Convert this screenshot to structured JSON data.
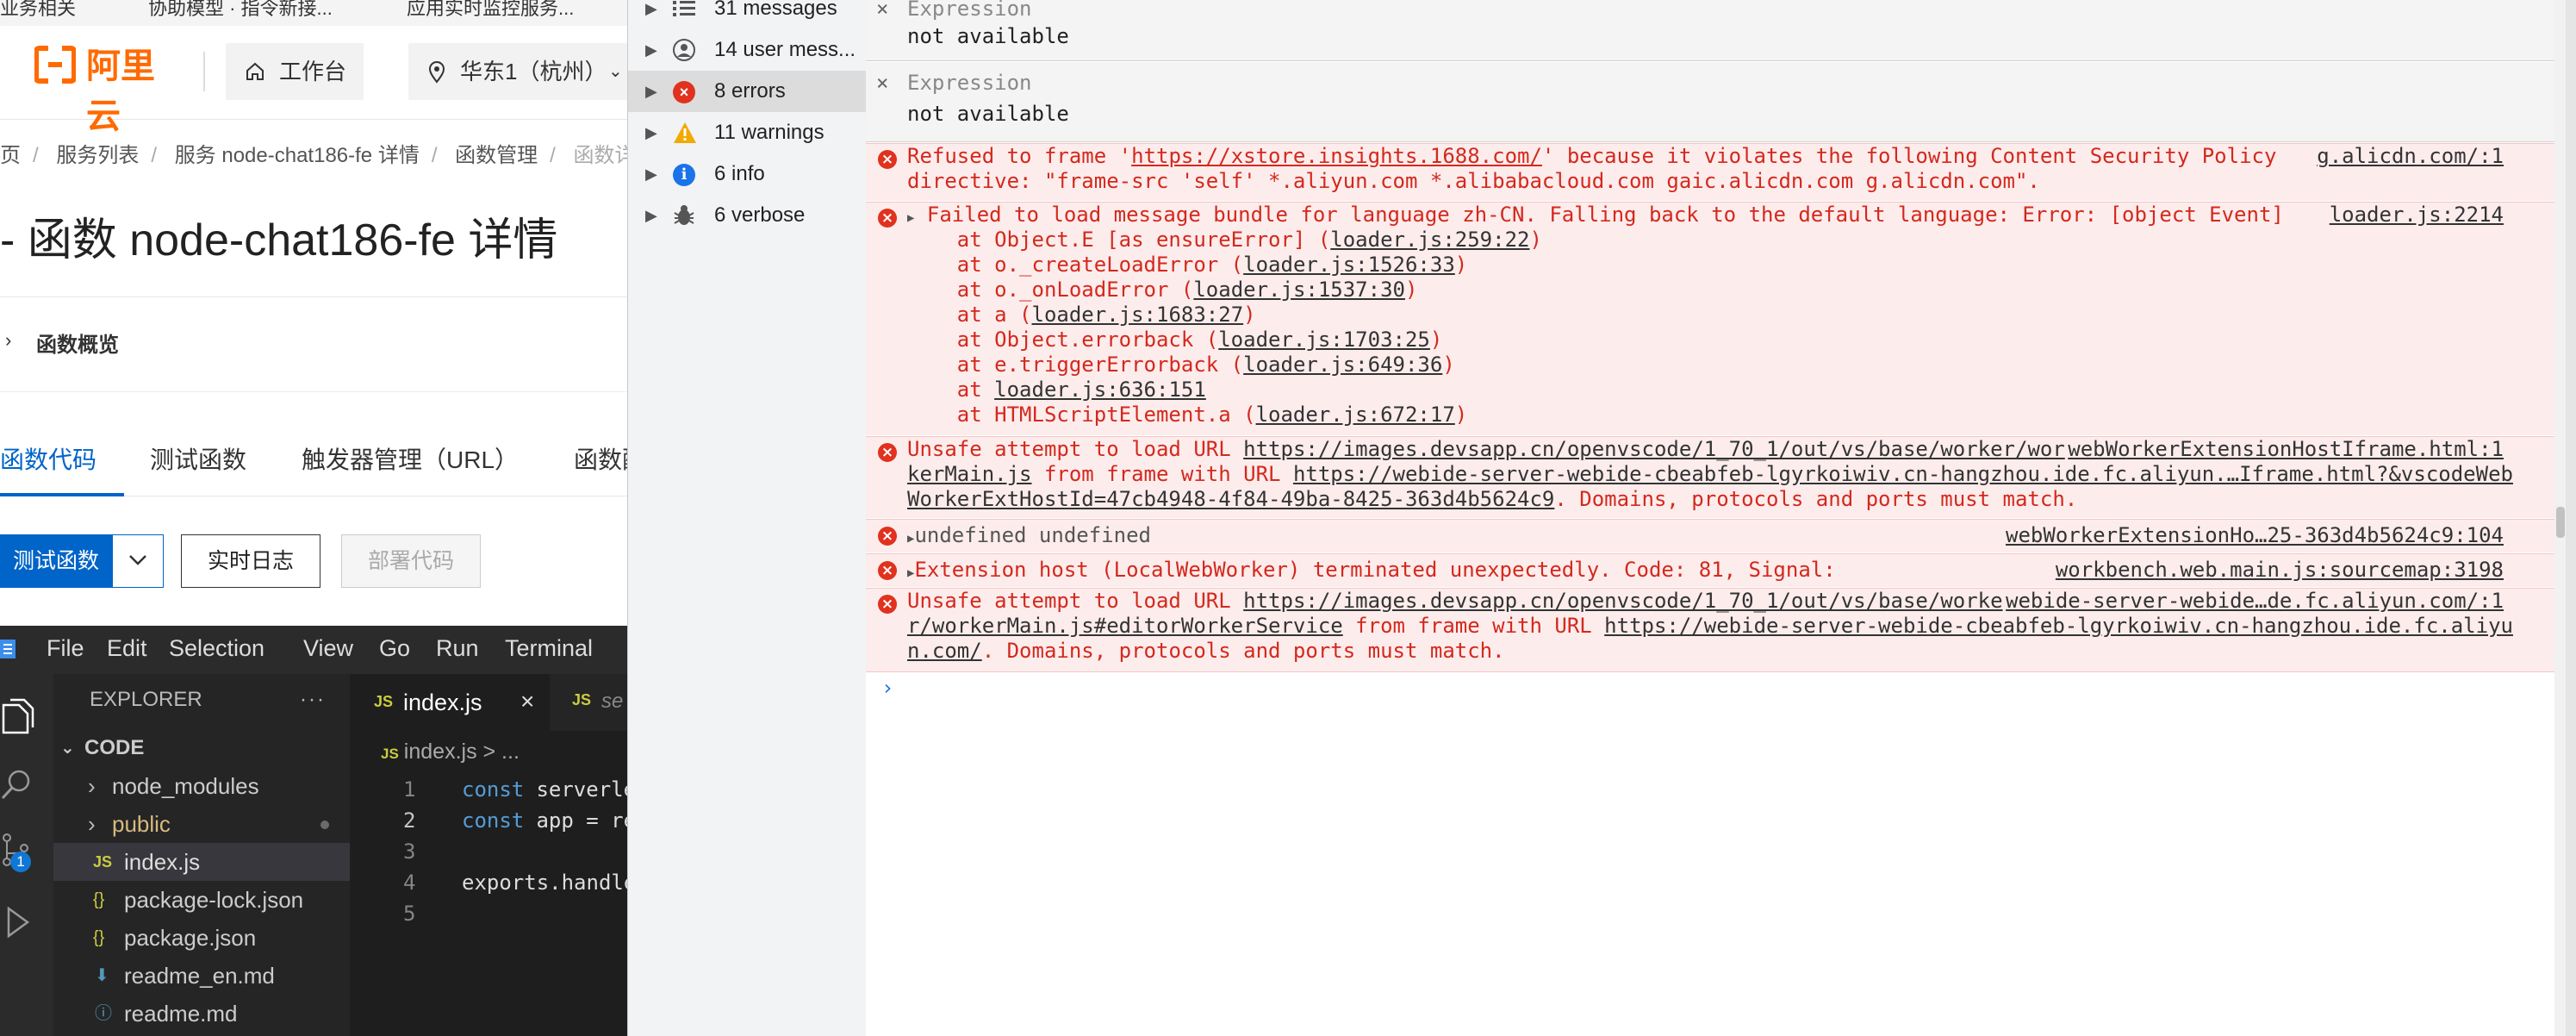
{
  "aliyun": {
    "bookmarks": [
      "业务相关",
      "协助模型 · 指令新接...",
      "应用实时监控服务..."
    ],
    "logo": "阿里云",
    "workbench": "工作台",
    "region": "华东1（杭州）",
    "breadcrumb": [
      "页",
      "服务列表",
      "服务 node-chat186-fe 详情",
      "函数管理",
      "函数详"
    ],
    "title": "- 函数 node-chat186-fe 详情",
    "overview": "函数概览",
    "tabs": [
      "函数代码",
      "测试函数",
      "触发器管理（URL）",
      "函数配"
    ],
    "buttons": {
      "test": "测试函数",
      "log": "实时日志",
      "deploy": "部署代码"
    }
  },
  "vscode": {
    "menu": [
      "File",
      "Edit",
      "Selection",
      "View",
      "Go",
      "Run",
      "Terminal"
    ],
    "explorer_title": "EXPLORER",
    "root": "CODE",
    "files": [
      {
        "name": "node_modules",
        "type": "folder"
      },
      {
        "name": "public",
        "type": "folder"
      },
      {
        "name": "index.js",
        "type": "js"
      },
      {
        "name": "package-lock.json",
        "type": "json"
      },
      {
        "name": "package.json",
        "type": "json"
      },
      {
        "name": "readme_en.md",
        "type": "md"
      },
      {
        "name": "readme.md",
        "type": "md"
      }
    ],
    "scm_badge": "1",
    "tab": "index.js",
    "tab2": "se",
    "editor_breadcrumb": "index.js > ...",
    "lines": [
      {
        "n": "1",
        "kw": "const",
        "rest": " serverle"
      },
      {
        "n": "2",
        "kw": "const",
        "rest": " app = re"
      },
      {
        "n": "3",
        "kw": "",
        "rest": ""
      },
      {
        "n": "4",
        "kw": "",
        "rest": "exports.handle"
      },
      {
        "n": "5",
        "kw": "",
        "rest": ""
      }
    ]
  },
  "sidebar": {
    "items": [
      {
        "label": "31 messages",
        "icon": "list-icon"
      },
      {
        "label": "14 user mess...",
        "icon": "user-icon"
      },
      {
        "label": "8 errors",
        "icon": "error-icon"
      },
      {
        "label": "11 warnings",
        "icon": "warning-icon"
      },
      {
        "label": "6 info",
        "icon": "info-icon"
      },
      {
        "label": "6 verbose",
        "icon": "bug-icon"
      }
    ]
  },
  "console": {
    "expressions": [
      {
        "title": "Expression",
        "value": "not available"
      },
      {
        "title": "Expression",
        "value": "not available"
      }
    ],
    "err1": {
      "l1a": "Refused to frame '",
      "l1link": "https://xstore.insights.1688.com/",
      "l1b": "' because it violates the following Content Security Policy",
      "l2": "directive: \"frame-src 'self' *.aliyun.com *.alibabacloud.com gaic.alicdn.com g.alicdn.com\".",
      "src": "g.alicdn.com/:1"
    },
    "err2": {
      "l1": "Failed to load message bundle for language zh-CN. Falling back to the default language: Error: [object Event]",
      "src": "loader.js:2214",
      "stack": [
        {
          "pre": "    at Object.E [as ensureError] (",
          "link": "loader.js:259:22",
          "post": ")"
        },
        {
          "pre": "    at o._createLoadError (",
          "link": "loader.js:1526:33",
          "post": ")"
        },
        {
          "pre": "    at o._onLoadError (",
          "link": "loader.js:1537:30",
          "post": ")"
        },
        {
          "pre": "    at a (",
          "link": "loader.js:1683:27",
          "post": ")"
        },
        {
          "pre": "    at Object.errorback (",
          "link": "loader.js:1703:25",
          "post": ")"
        },
        {
          "pre": "    at e.triggerErrorback (",
          "link": "loader.js:649:36",
          "post": ")"
        },
        {
          "pre": "    at ",
          "link": "loader.js:636:151",
          "post": ""
        },
        {
          "pre": "    at HTMLScriptElement.a (",
          "link": "loader.js:672:17",
          "post": ")"
        }
      ]
    },
    "err3": {
      "l1a": "Unsafe attempt to load URL ",
      "l1link": "https://images.devsapp.cn/openvscode/1_70_1/out/vs/base/worker/wor",
      "l2link": "kerMain.js",
      "l2b": " from frame with URL ",
      "l2link2": "https://webide-server-webide-cbeabfeb-lgyrkoiwiv.cn-hangzhou.ide.fc.aliyun.…Iframe.html?&vscodeWeb",
      "l3link": "WorkerExtHostId=47cb4948-4f84-49ba-8425-363d4b5624c9",
      "l3b": ". Domains, protocols and ports must match.",
      "src": "webWorkerExtensionHostIframe.html:1"
    },
    "err4": {
      "text": "undefined undefined",
      "src": "webWorkerExtensionHo…25-363d4b5624c9:104"
    },
    "err5": {
      "text": "Extension host (LocalWebWorker) terminated unexpectedly. Code: 81, Signal:",
      "src": "workbench.web.main.js:sourcemap:3198"
    },
    "err6": {
      "l1a": "Unsafe attempt to load URL ",
      "l1link": "https://images.devsapp.cn/openvscode/1_70_1/out/vs/base/worke",
      "l2link": "r/workerMain.js#editorWorkerService",
      "l2b": " from frame with URL ",
      "l2link2": "https://webide-server-webide-cbeabfeb-lgyrkoiwiv.cn-hangzhou.ide.fc.aliyu",
      "l3link": "n.com/",
      "l3b": ". Domains, protocols and ports must match.",
      "src": "webide-server-webide…de.fc.aliyun.com/:1"
    },
    "prompt": "›"
  }
}
